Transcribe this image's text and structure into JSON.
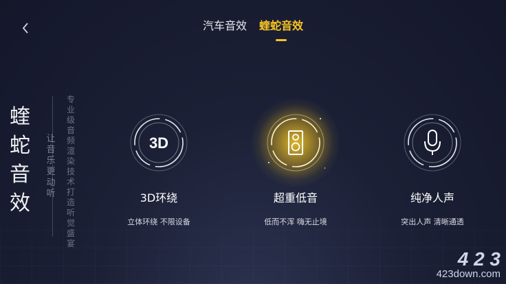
{
  "nav": {
    "back_icon": "chevron-left-icon"
  },
  "tabs": [
    {
      "label": "汽车音效",
      "active": false
    },
    {
      "label": "蝰蛇音效",
      "active": true
    }
  ],
  "side": {
    "title": "蝰蛇音效",
    "subtitle": "让音乐更动听",
    "tagline": "专业级音频渲染技术打造听觉盛宴"
  },
  "features": [
    {
      "icon": "3d-icon",
      "icon_text": "3D",
      "title": "3D环绕",
      "desc": "立体环绕 不限设备"
    },
    {
      "icon": "speaker-icon",
      "title": "超重低音",
      "desc": "低而不浑 嗨无止境"
    },
    {
      "icon": "microphone-icon",
      "title": "纯净人声",
      "desc": "突出人声 清晰通透"
    }
  ],
  "watermark": {
    "logo": "4 2 3",
    "site": "423down.com"
  },
  "colors": {
    "accent": "#f7c423",
    "background": "#1c2036"
  }
}
